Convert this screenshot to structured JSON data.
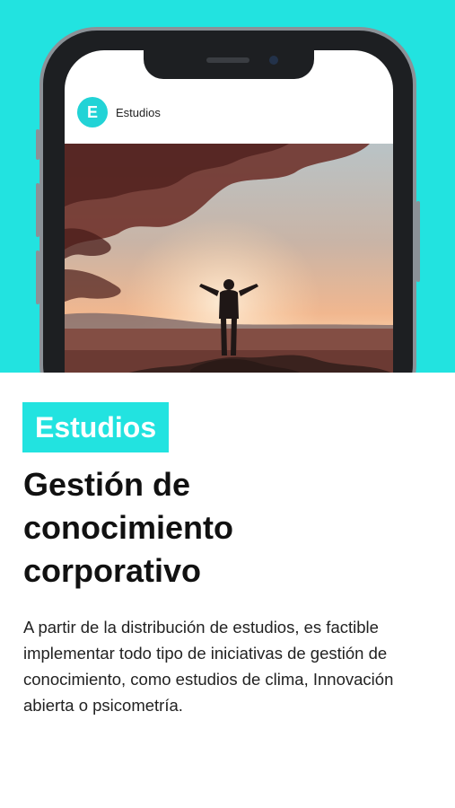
{
  "app": {
    "logo_letter": "E",
    "name": "Estudios"
  },
  "badge": "Estudios",
  "headline": {
    "line1": "Gestión de",
    "line2": "conocimiento",
    "line3": "corporativo"
  },
  "description": "A partir de la distribución de estudios, es factible implementar todo tipo de iniciativas de gestión de conocimiento, como estudios de clima, Innovación abierta o psicometría.",
  "colors": {
    "accent": "#22e3e0",
    "logo": "#22d3d6",
    "phone_frame": "#1d1f22"
  },
  "photo": "silhouette-arms-raised-sunset"
}
